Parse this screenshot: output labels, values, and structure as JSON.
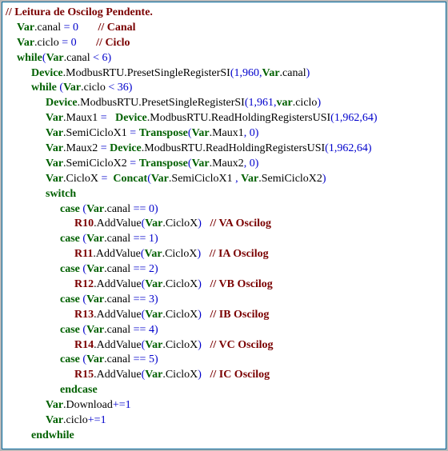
{
  "comments": {
    "title": "// Leitura de Oscilog Pendente.",
    "canal": "// Canal",
    "ciclo": "// Ciclo",
    "va": "// VA Oscilog",
    "ia": "// IA Oscilog",
    "vb": "// VB Oscilog",
    "ib": "// IB Oscilog",
    "vc": "// VC Oscilog",
    "ic": "// IC Oscilog"
  },
  "tok": {
    "Var": "Var",
    "var": "var",
    "Device": "Device",
    "while": "while",
    "whileSp": "while ",
    "switch": "switch",
    "case": "case",
    "endcase": "endcase",
    "endwhile": "endwhile",
    "Transpose": "Transpose",
    "Concat": "Concat",
    "ModbusRTU": "ModbusRTU",
    "PresetSingleRegisterSI": "PresetSingleRegisterSI",
    "ReadHoldingRegistersUSI": "ReadHoldingRegistersUSI",
    "AddValue": "AddValue",
    "canal": "canal",
    "ciclo": "ciclo",
    "Maux1": "Maux1",
    "Maux2": "Maux2",
    "SemiCicloX1": "SemiCicloX1",
    "SemiCicloX2": "SemiCicloX2",
    "CicloX": "CicloX",
    "Download": "Download"
  },
  "rtags": {
    "R10": "R10",
    "R11": "R11",
    "R12": "R12",
    "R13": "R13",
    "R14": "R14",
    "R15": "R15"
  },
  "nums": {
    "n0": "0",
    "n1": "1",
    "n2": "2",
    "n3": "3",
    "n4": "4",
    "n5": "5",
    "n6": "6",
    "n36": "36",
    "n64": "64",
    "n960": "960",
    "n961": "961",
    "n962": "962"
  },
  "ops": {
    "eq": " = ",
    "eqTight": "=",
    "eqL": " =   ",
    "eqS": " =  ",
    "lt": " < ",
    "deq": " == ",
    "peq": "+=",
    "dot": ".",
    "lp": "(",
    "rp": ")",
    "comma": ",",
    "commaSp": " , "
  }
}
